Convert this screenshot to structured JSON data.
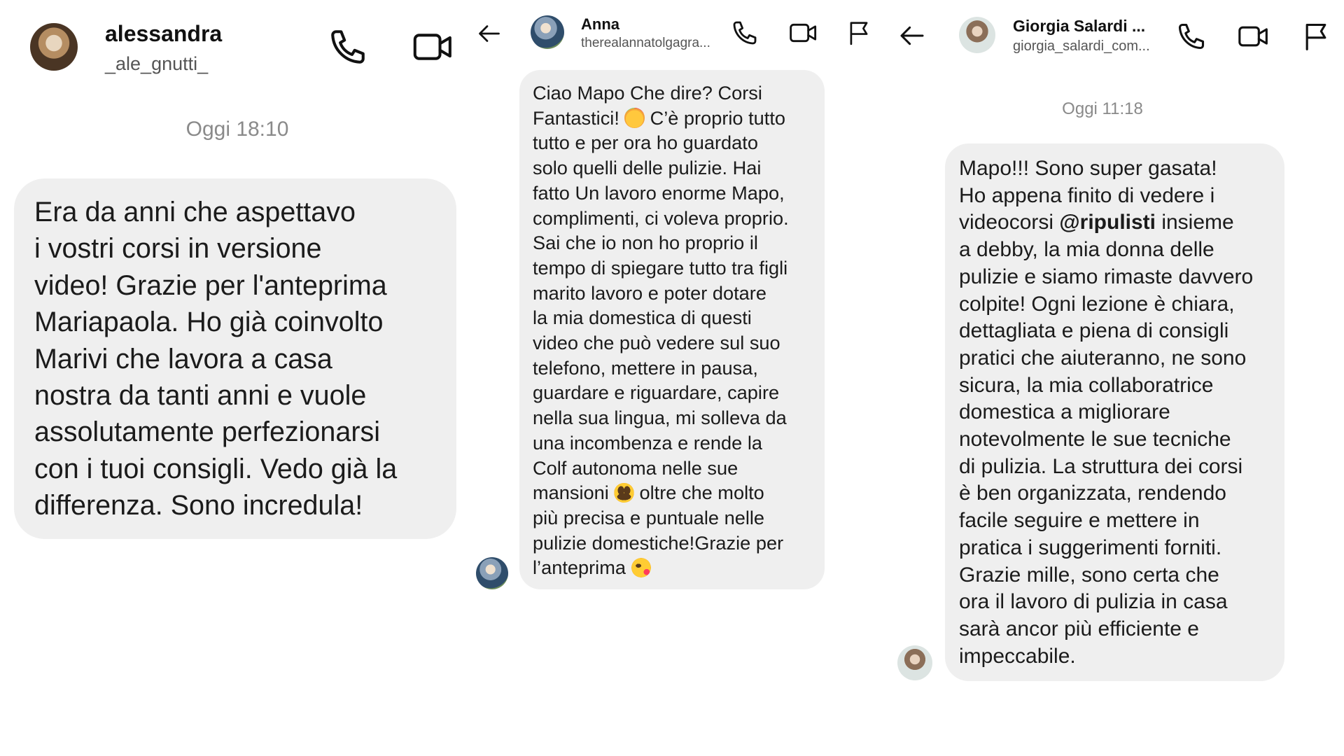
{
  "panel1": {
    "header": {
      "name": "alessandra",
      "handle": "_ale_gnutti_",
      "icons": [
        "phone-icon",
        "video-camera-icon"
      ]
    },
    "timestamp": "Oggi 18:10",
    "message": "Era da anni che aspettavo\ni vostri corsi in versione\nvideo! Grazie per l'anteprima\nMariapaola. Ho già coinvolto\nMarivi che lavora a casa\nnostra da tanti anni e vuole\nassolutamente perfezionarsi\ncon i tuoi consigli.  Vedo già la\ndifferenza. Sono incredula!"
  },
  "panel2": {
    "header": {
      "name": "Anna",
      "handle": "therealannatolgagra...",
      "icons": [
        "back-arrow-icon",
        "phone-icon",
        "video-camera-icon",
        "flag-icon"
      ]
    },
    "message_lines": [
      "Ciao Mapo Che dire? Corsi",
      "Fantastici!",
      " C’è proprio tutto",
      "tutto e per ora ho guardato",
      "solo quelli delle pulizie. Hai",
      "fatto Un lavoro enorme Mapo,",
      "complimenti, ci voleva proprio.",
      "Sai che io non ho proprio il",
      "tempo di spiegare tutto tra figli",
      "marito lavoro e poter dotare",
      "la mia domestica di questi",
      "video che può vedere sul suo",
      "telefono, mettere in pausa,",
      "guardare e riguardare, capire",
      "nella sua lingua, mi solleva da",
      "una incombenza e rende la",
      "Colf autonoma nelle sue",
      "mansioni",
      " oltre che molto",
      "più precisa e puntuale nelle",
      "pulizie domestiche!Grazie per",
      "l’anteprima"
    ],
    "emojis": [
      "party-face-emoji",
      "smiley-emoji",
      "kiss-emoji"
    ]
  },
  "panel3": {
    "header": {
      "name": "Giorgia Salardi ...",
      "handle": "giorgia_salardi_com...",
      "icons": [
        "back-arrow-icon",
        "phone-icon",
        "video-camera-icon",
        "flag-icon"
      ]
    },
    "timestamp": "Oggi 11:18",
    "message_before_mention": "Mapo!!! Sono super gasata!\nHo appena finito di vedere i\nvideocorsi ",
    "mention": "@ripulisti",
    "message_after_mention": " insieme\na debby, la mia donna delle\npulizie e siamo  rimaste davvero\ncolpite! Ogni lezione è chiara,\ndettagliata e piena di consigli\npratici che aiuteranno, ne sono\nsicura, la mia collaboratrice\ndomestica a migliorare\nnotevolmente le sue tecniche\ndi pulizia. La struttura dei corsi\nè ben organizzata, rendendo\nfacile seguire e mettere in\npratica i suggerimenti forniti.\nGrazie mille, sono certa che\nora il lavoro di pulizia in casa\nsarà ancor più efficiente e\nimpeccabile."
  },
  "colors": {
    "bubble": "#efefef",
    "timestamp": "#8a8a8a",
    "icon": "#111111"
  }
}
